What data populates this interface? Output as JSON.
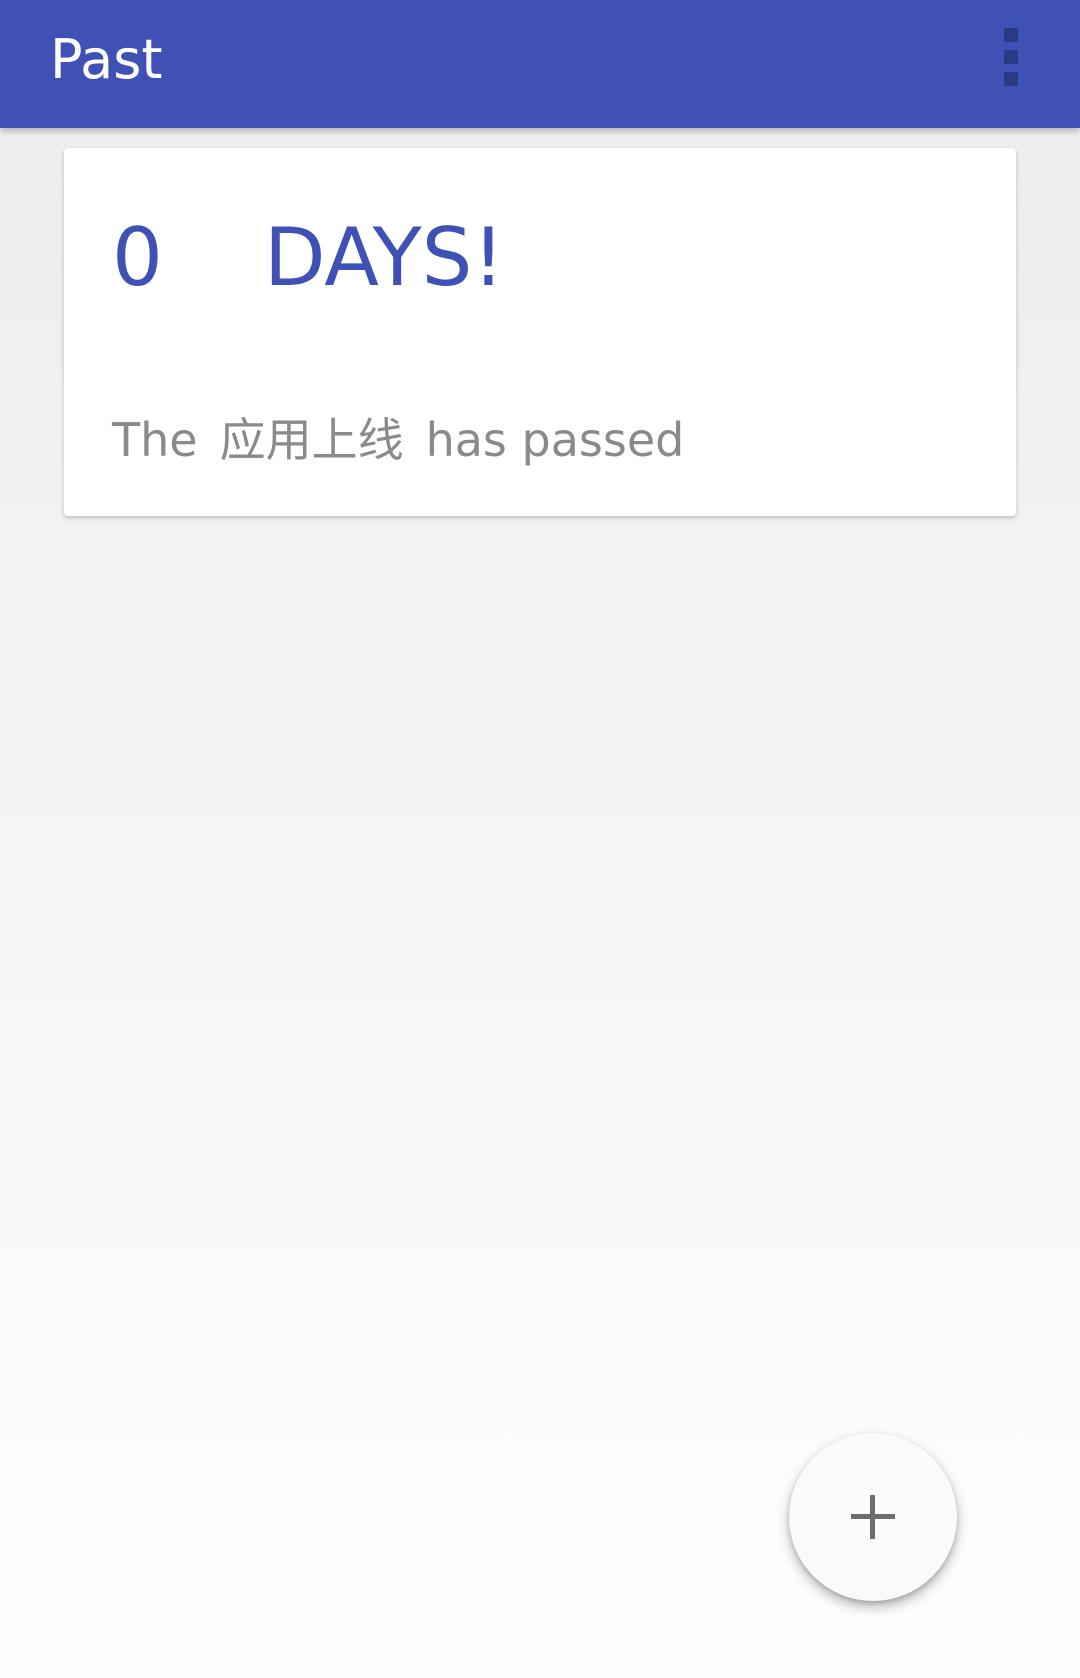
{
  "app_bar": {
    "title": "Past",
    "overflow_icon": "more-vert-icon"
  },
  "card": {
    "days_count": "0",
    "days_label": "DAYS!",
    "prefix": "The",
    "event_name": "应用上线",
    "suffix": "has passed"
  },
  "fab": {
    "icon": "plus-icon"
  },
  "colors": {
    "primary": "#3f51b5",
    "muted_text": "#8a8a8a"
  }
}
